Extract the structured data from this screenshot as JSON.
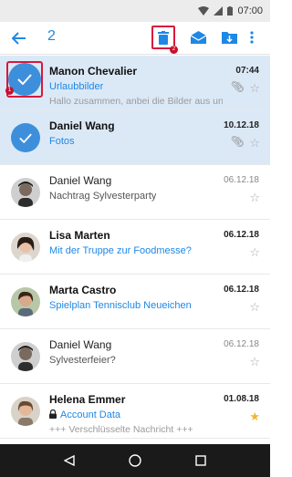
{
  "status_bar": {
    "time": "07:00"
  },
  "app_bar": {
    "selected_count": "2",
    "icons": [
      "back-arrow-icon",
      "trash-icon",
      "envelope-open-icon",
      "folder-download-icon",
      "more-vert-icon"
    ],
    "accent_color": "#1e88e5",
    "highlight_color": "#d7193d"
  },
  "messages": [
    {
      "name": "Manon Chevalier",
      "subject": "Urlaubbilder",
      "preview": "Hallo zusammen, anbei die Bilder aus unserem ...",
      "date": "07:44",
      "unread": true,
      "selected": true,
      "attachment": true,
      "starred": false
    },
    {
      "name": "Daniel Wang",
      "subject": "Fotos",
      "preview": "",
      "date": "10.12.18",
      "unread": true,
      "selected": true,
      "attachment": true,
      "starred": false
    },
    {
      "name": "Daniel Wang",
      "subject": "Nachtrag Sylvesterparty",
      "preview": "",
      "date": "06.12.18",
      "unread": false,
      "selected": false,
      "attachment": false,
      "starred": false
    },
    {
      "name": "Lisa Marten",
      "subject": "Mit der Truppe zur Foodmesse?",
      "preview": "",
      "date": "06.12.18",
      "unread": true,
      "selected": false,
      "attachment": false,
      "starred": false
    },
    {
      "name": "Marta Castro",
      "subject": "Spielplan Tennisclub Neueichen",
      "preview": "",
      "date": "06.12.18",
      "unread": true,
      "selected": false,
      "attachment": false,
      "starred": false
    },
    {
      "name": "Daniel Wang",
      "subject": "Sylvesterfeier?",
      "preview": "",
      "date": "06.12.18",
      "unread": false,
      "selected": false,
      "attachment": false,
      "starred": false
    },
    {
      "name": "Helena Emmer",
      "subject": "Account Data",
      "preview": "+++ Verschlüsselte Nachricht +++",
      "date": "01.08.18",
      "unread": true,
      "selected": false,
      "attachment": false,
      "starred": true,
      "encrypted": true
    }
  ]
}
